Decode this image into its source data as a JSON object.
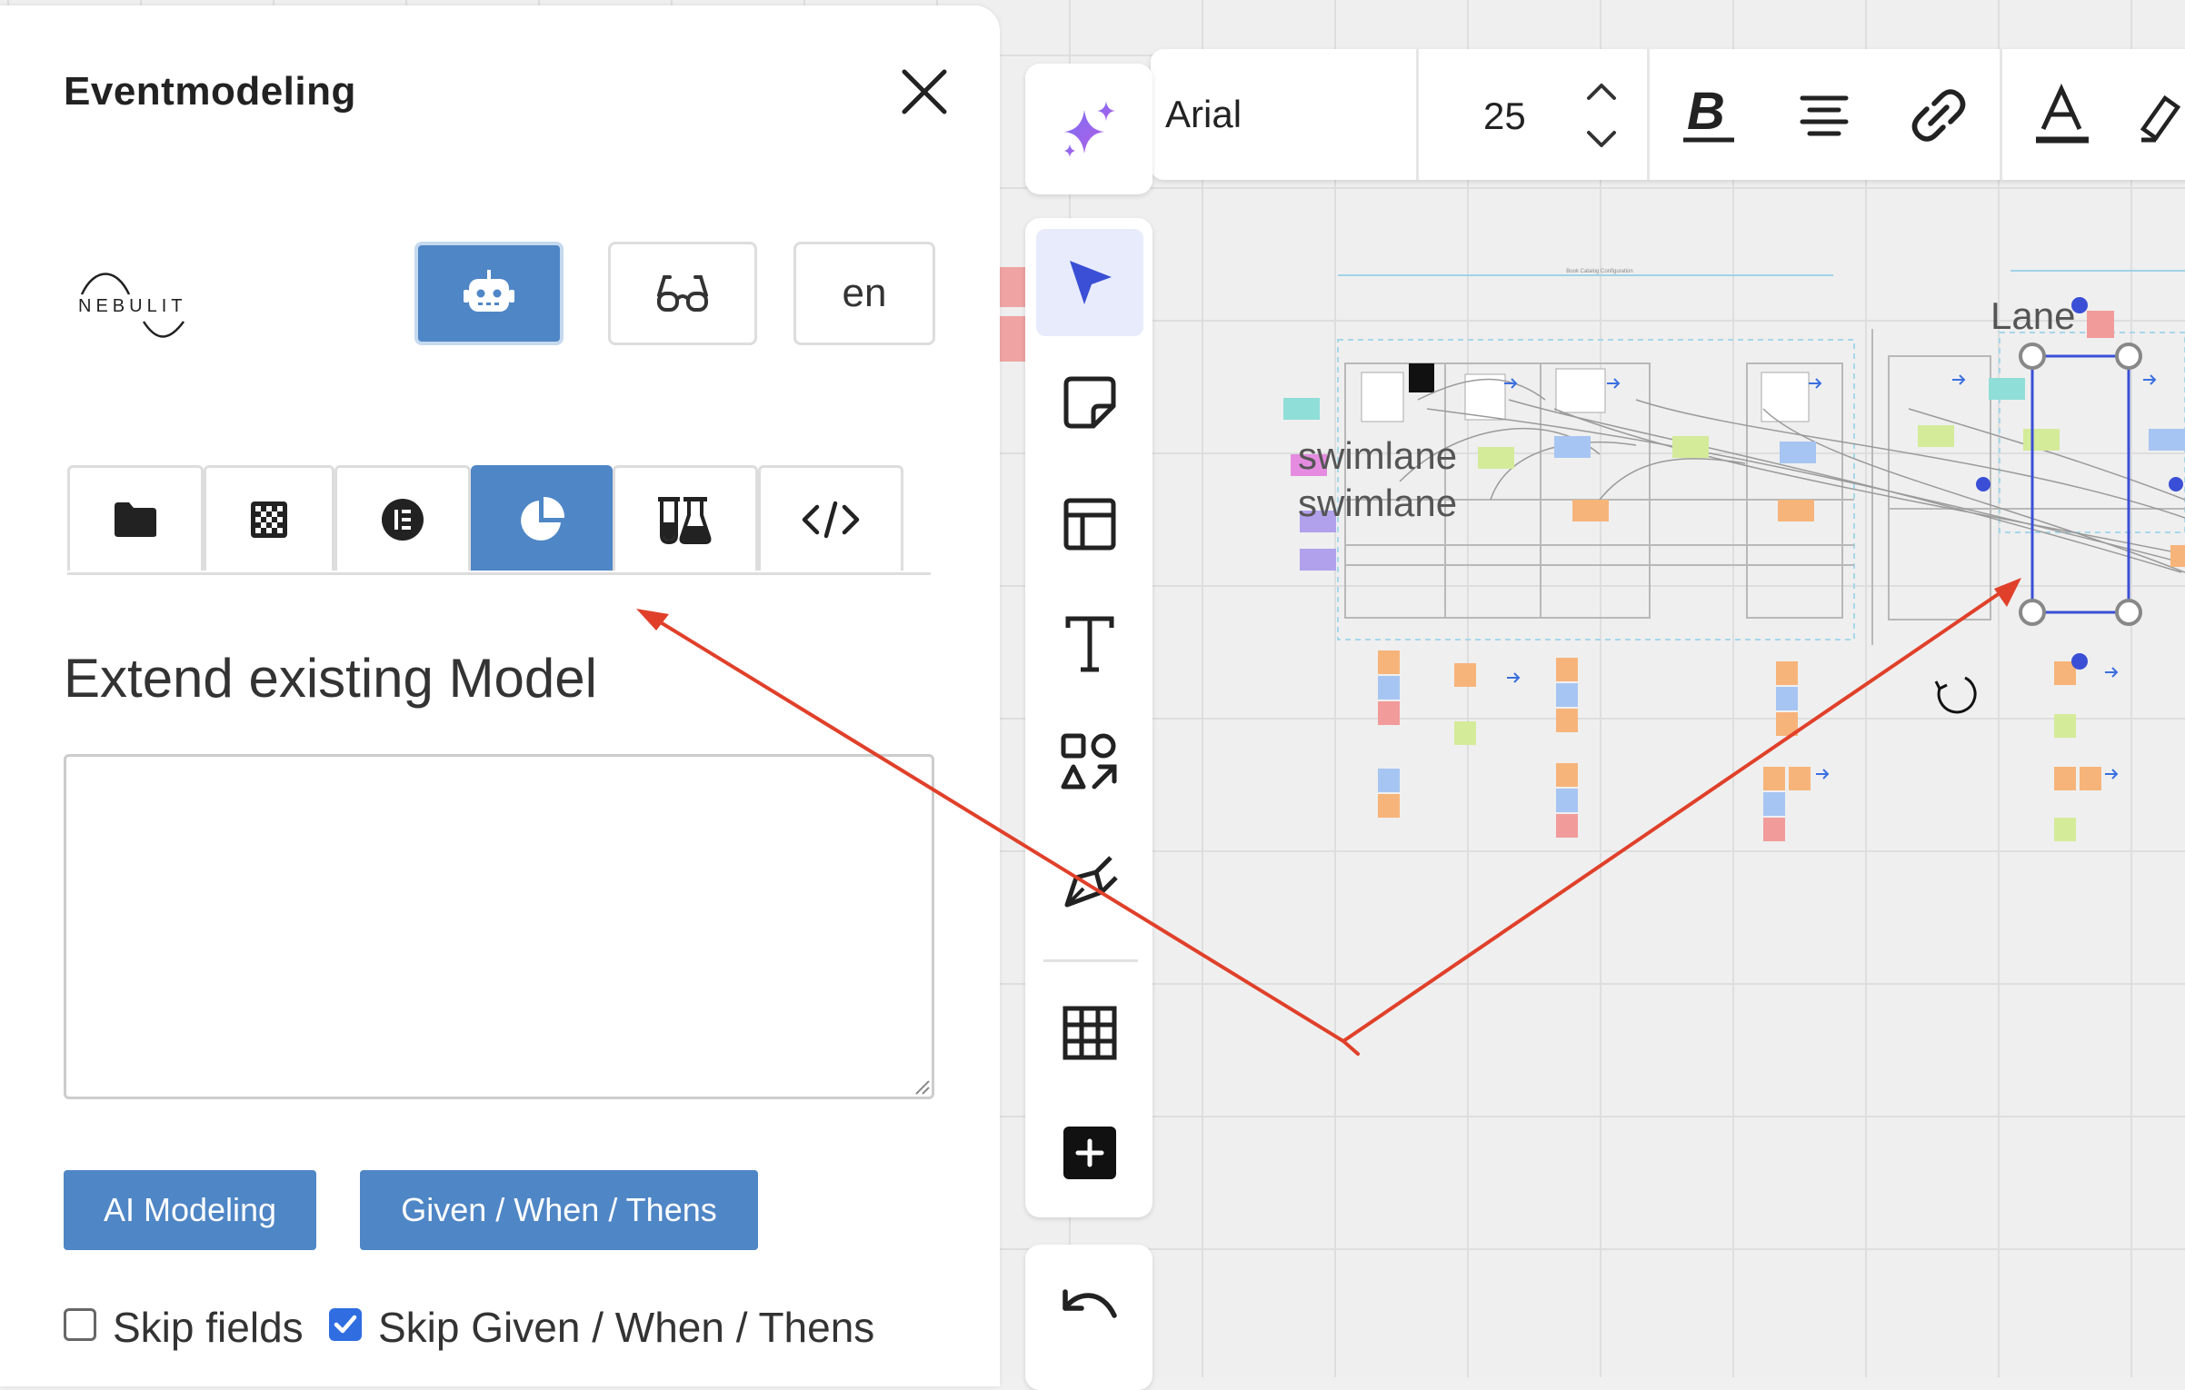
{
  "panel": {
    "title": "Eventmodeling",
    "logo_text": "NEBULIT",
    "language": "en",
    "tabs": [
      {
        "icon": "folder-icon"
      },
      {
        "icon": "checkerboard-icon"
      },
      {
        "icon": "elementor-icon"
      },
      {
        "icon": "pie-chart-icon",
        "active": true
      },
      {
        "icon": "flask-icon"
      },
      {
        "icon": "code-icon"
      }
    ],
    "section_title": "Extend existing Model",
    "textarea_value": "",
    "ai_button": "AI Modeling",
    "gwt_button": "Given / When / Thens",
    "skip_fields_label": "Skip fields",
    "skip_fields_checked": false,
    "skip_gwt_label": "Skip Given / When / Thens",
    "skip_gwt_checked": true
  },
  "toolbar": {
    "font": "Arial",
    "font_size": "25",
    "accent": "#3a4fd6"
  },
  "canvas": {
    "lane_label": "Lane",
    "swimlane_1": "swimlane",
    "swimlane_2": "swimlane",
    "tiny_title": "Book Catalog Configuration"
  },
  "colors": {
    "primary_button": "#4f86c6",
    "annotation_arrow": "#e0402a"
  }
}
